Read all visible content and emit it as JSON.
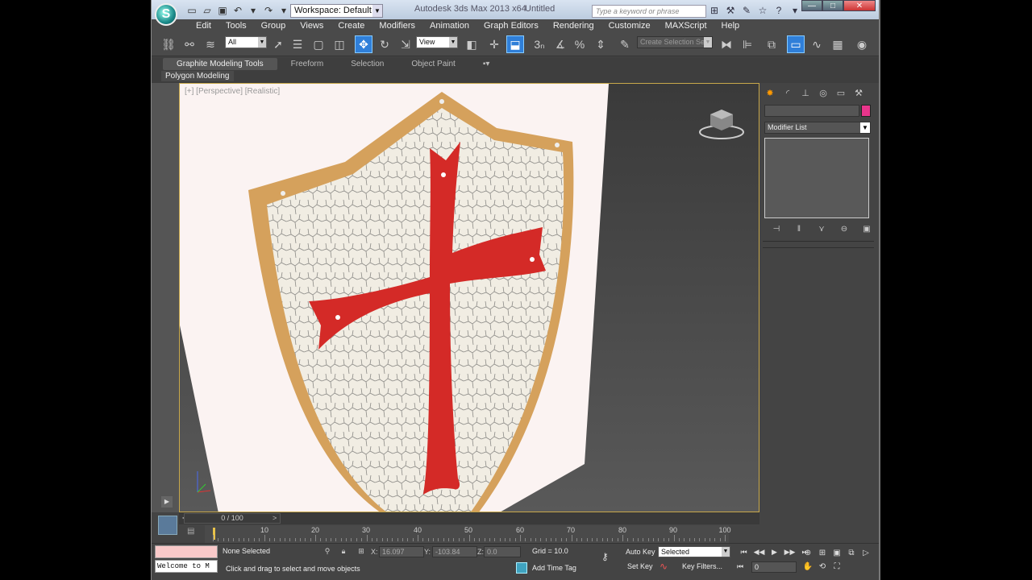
{
  "titlebar": {
    "workspace": "Workspace: Default",
    "app_title": "Autodesk 3ds Max  2013 x64",
    "file_name": "Untitled",
    "search_placeholder": "Type a keyword or phrase"
  },
  "menu": [
    "Edit",
    "Tools",
    "Group",
    "Views",
    "Create",
    "Modifiers",
    "Animation",
    "Graph Editors",
    "Rendering",
    "Customize",
    "MAXScript",
    "Help"
  ],
  "toolbar": {
    "filter_value": "All",
    "ref_coord_value": "View",
    "named_selection_placeholder": "Create Selection Se"
  },
  "ribbon": {
    "tabs": [
      "Graphite Modeling Tools",
      "Freeform",
      "Selection",
      "Object Paint"
    ],
    "panel_label": "Polygon Modeling"
  },
  "viewport": {
    "label": "[+] [Perspective] [Realistic]"
  },
  "command_panel": {
    "modifier_list": "Modifier List",
    "object_color": "#e8358b"
  },
  "time_slider": {
    "value": "0 / 100"
  },
  "trackbar": {
    "ticks": [
      "10",
      "20",
      "30",
      "40",
      "50",
      "60",
      "70",
      "80",
      "90",
      "100"
    ]
  },
  "status": {
    "maxscript_text": "Welcome to M",
    "selection": "None Selected",
    "prompt": "Click and drag to select and move objects",
    "x_label": "X:",
    "x_value": "16.097",
    "y_label": "Y:",
    "y_value": "-103.84",
    "z_label": "Z:",
    "z_value": "0.0",
    "grid": "Grid = 10.0",
    "add_time_tag": "Add Time Tag",
    "auto_key": "Auto Key",
    "set_key": "Set Key",
    "key_mode": "Selected",
    "key_filters": "Key Filters...",
    "current_frame": "0"
  }
}
